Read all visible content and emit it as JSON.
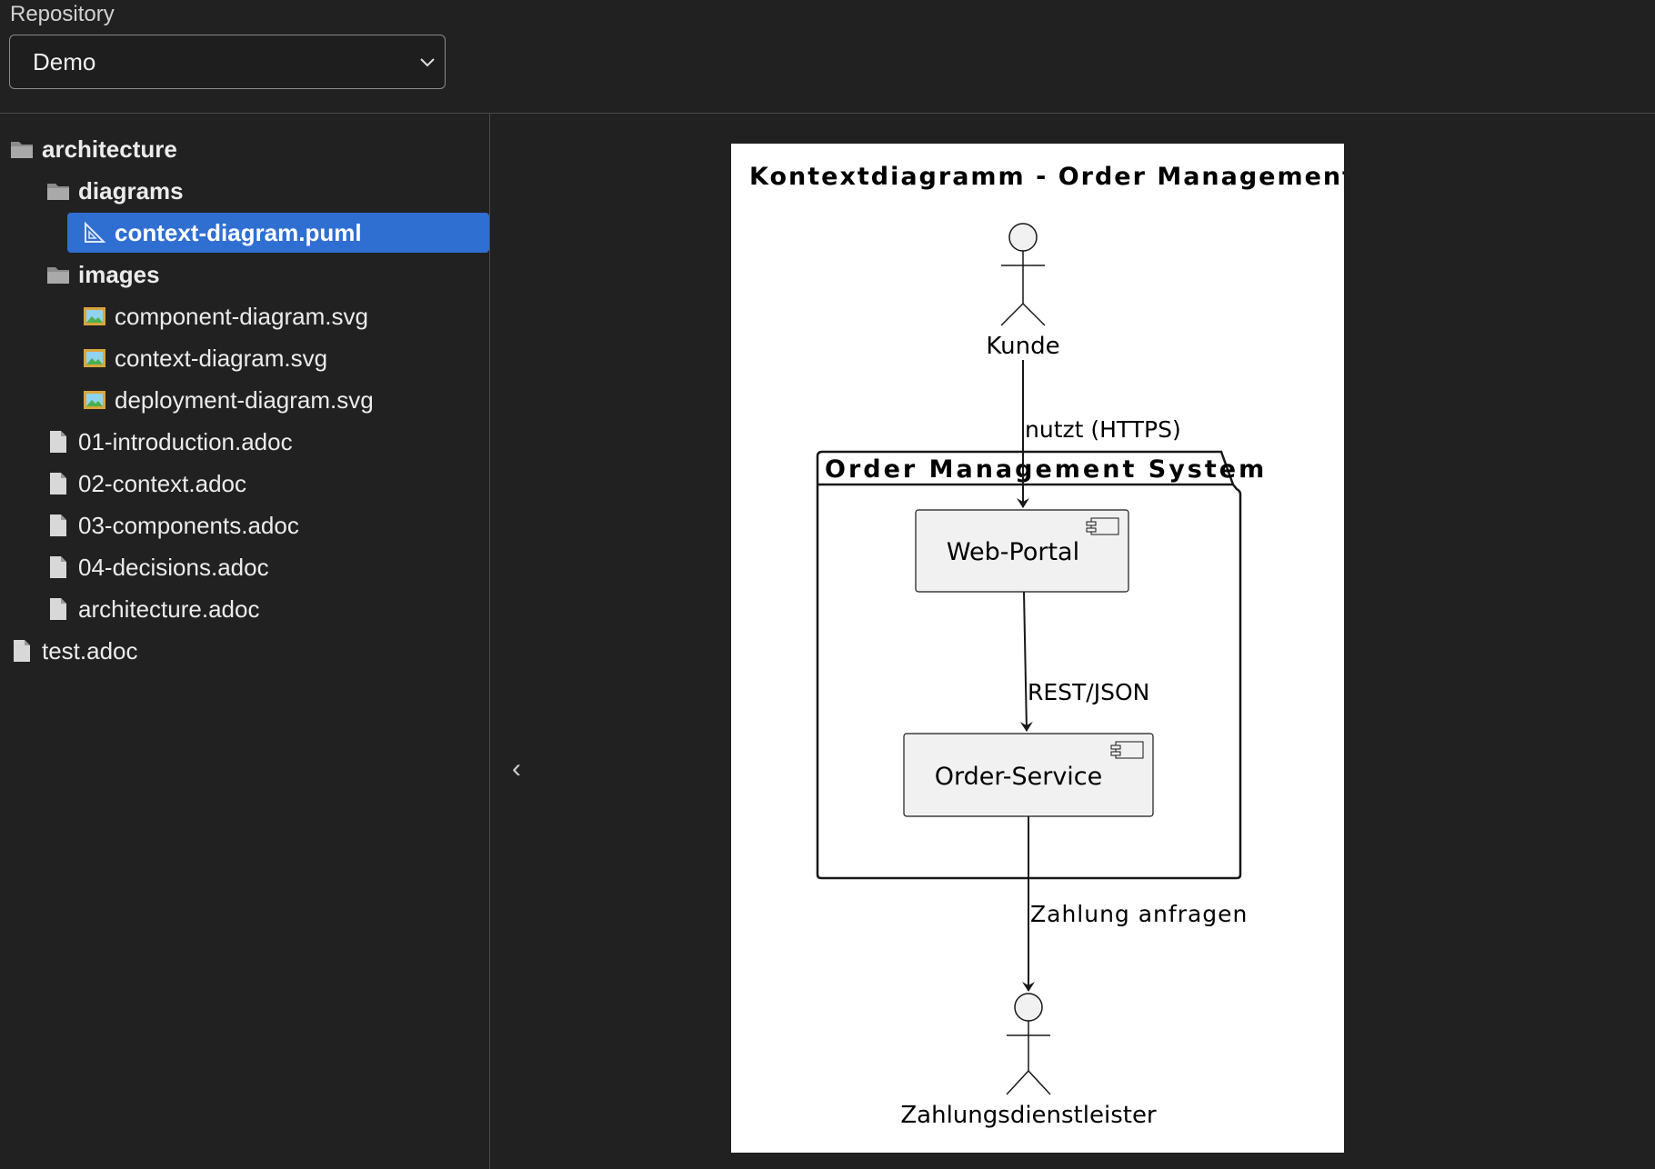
{
  "repository": {
    "label": "Repository",
    "selected": "Demo"
  },
  "tree": {
    "architecture": "architecture",
    "diagrams": "diagrams",
    "context_puml": "context-diagram.puml",
    "images": "images",
    "component_svg": "component-diagram.svg",
    "context_svg": "context-diagram.svg",
    "deployment_svg": "deployment-diagram.svg",
    "intro": "01-introduction.adoc",
    "context": "02-context.adoc",
    "components": "03-components.adoc",
    "decisions": "04-decisions.adoc",
    "arch_doc": "architecture.adoc",
    "test": "test.adoc"
  },
  "collapse_glyph": "‹",
  "diagram": {
    "title": "Kontextdiagramm - Order Management",
    "actor_kunde": "Kunde",
    "edge_nutzt": "nutzt (HTTPS)",
    "package": "Order Management System",
    "web_portal": "Web-Portal",
    "edge_rest": "REST/JSON",
    "order_service": "Order-Service",
    "edge_zahlung": "Zahlung anfragen",
    "actor_zahlung": "Zahlungsdienstleister"
  }
}
